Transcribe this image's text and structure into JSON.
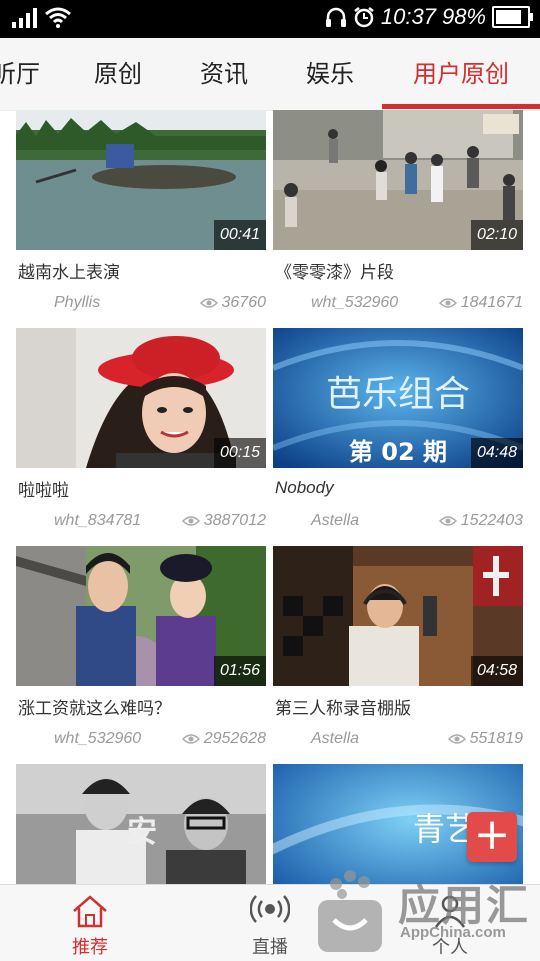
{
  "status_bar": {
    "time": "10:37",
    "battery": "98%",
    "battery_level": 0.98
  },
  "tabs": [
    {
      "label": "听厅"
    },
    {
      "label": "原创"
    },
    {
      "label": "资讯"
    },
    {
      "label": "娱乐"
    },
    {
      "label": "用户原创",
      "active": true
    }
  ],
  "videos": [
    {
      "title": "越南水上表演",
      "author": "Phyllis",
      "views": "36760",
      "duration": "00:41",
      "thumb": "boat-on-water"
    },
    {
      "title": "《零零漆》片段",
      "author": "wht_532960",
      "views": "1841671",
      "duration": "02:10",
      "thumb": "village-crowd"
    },
    {
      "title": "啦啦啦",
      "author": "wht_834781",
      "views": "3887012",
      "duration": "00:15",
      "thumb": "woman-red-hat"
    },
    {
      "title": "Nobody",
      "author": "Astella",
      "views": "1522403",
      "duration": "04:48",
      "thumb": "show-title-card",
      "thumb_text": "芭乐组合",
      "thumb_sub": "第 02 期"
    },
    {
      "title": "涨工资就这么难吗？",
      "author": "wht_532960",
      "views": "2952628",
      "duration": "01:56",
      "thumb": "costume-drama"
    },
    {
      "title": "第三人称录音棚版",
      "author": "Astella",
      "views": "551819",
      "duration": "04:58",
      "thumb": "recording-studio"
    },
    {
      "title": "",
      "author": "",
      "views": "",
      "duration": "",
      "thumb": "two-boys",
      "thumb_text": "安"
    },
    {
      "title": "",
      "author": "",
      "views": "",
      "duration": "",
      "thumb": "blue-title-card",
      "thumb_text": "青艺"
    }
  ],
  "fab": {
    "label": "+"
  },
  "bottom_nav": [
    {
      "label": "推荐",
      "icon": "home-icon",
      "active": true
    },
    {
      "label": "直播",
      "icon": "broadcast-icon"
    },
    {
      "label": "个人",
      "icon": "person-icon"
    }
  ],
  "watermark": {
    "text": "应用汇",
    "sub": "AppChina.com"
  },
  "colors": {
    "accent": "#d22f2f",
    "fab": "#e24b49"
  }
}
